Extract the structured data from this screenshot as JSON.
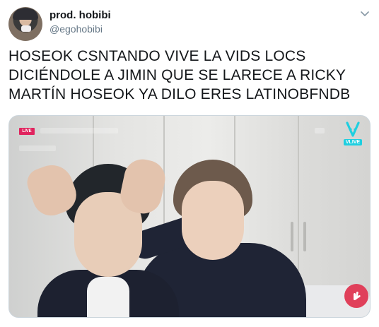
{
  "tweet": {
    "display_name": "prod. hobibi",
    "handle": "@egohobibi",
    "text_lines": [
      "HOSEOK CSNTANDO VIVE LA VIDS LOCS",
      "DICIÉNDOLE A JIMIN QUE SE LARECE A RICKY",
      "MARTÍN HOSEOK YA DILO ERES LATINOBFNDB"
    ]
  },
  "media": {
    "live_label": "LIVE",
    "vlive_label": "VLIVE"
  },
  "colors": {
    "primary_text": "#14171a",
    "secondary_text": "#657786",
    "live_badge": "#e0245e",
    "vlive_brand": "#1ecfe0",
    "heart_button": "#e0405a"
  },
  "icons": {
    "caret": "chevron-down-icon",
    "vlive": "vlive-logo-icon",
    "heart": "heart-hand-icon"
  }
}
